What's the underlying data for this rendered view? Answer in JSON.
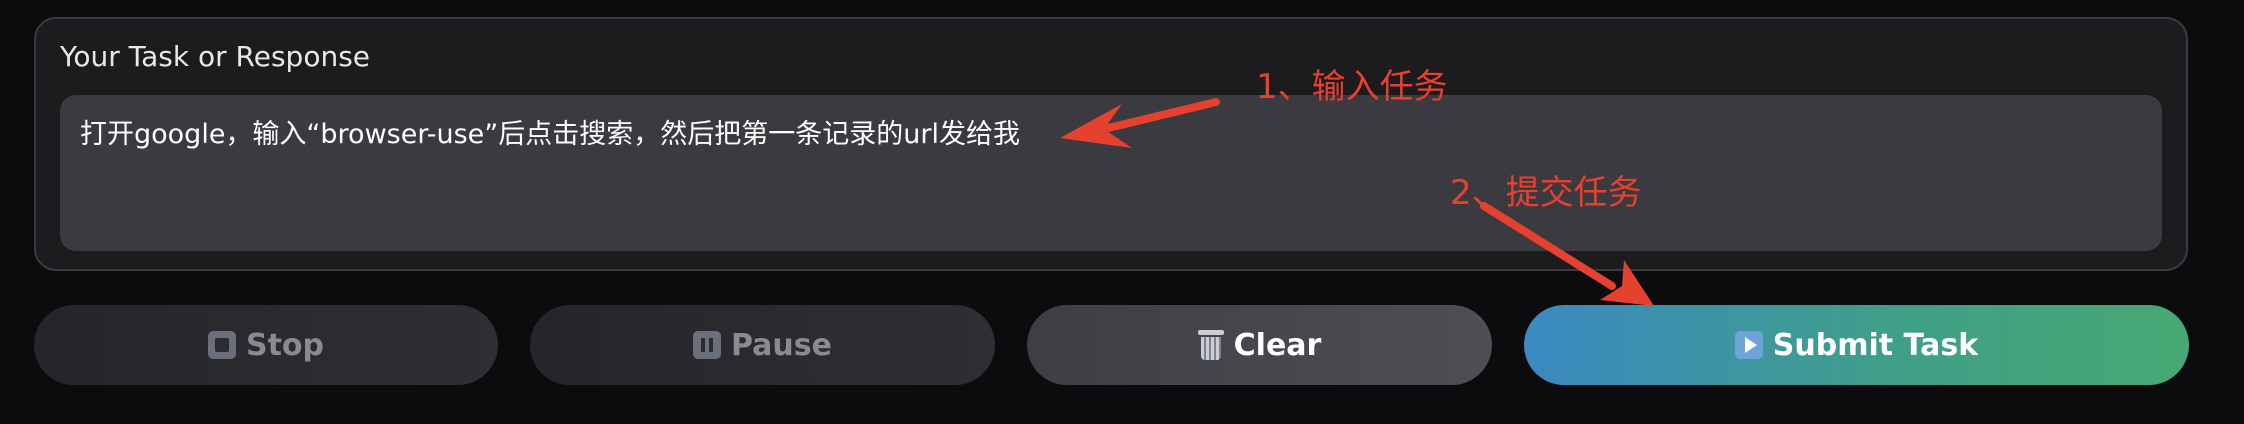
{
  "panel": {
    "label": "Your Task or Response",
    "task_value": "打开google，输入“browser-use”后点击搜索，然后把第一条记录的url发给我"
  },
  "buttons": {
    "stop_label": "Stop",
    "pause_label": "Pause",
    "clear_label": "Clear",
    "submit_label": "Submit Task"
  },
  "annotations": {
    "step1": "1、输入任务",
    "step2": "2、提交任务"
  },
  "colors": {
    "annotation": "#e6412e",
    "submit_gradient_start": "#3b89c2",
    "submit_gradient_end": "#48a873"
  },
  "icons": {
    "stop": "stop-icon",
    "pause": "pause-icon",
    "clear": "trash-icon",
    "submit": "play-icon"
  }
}
